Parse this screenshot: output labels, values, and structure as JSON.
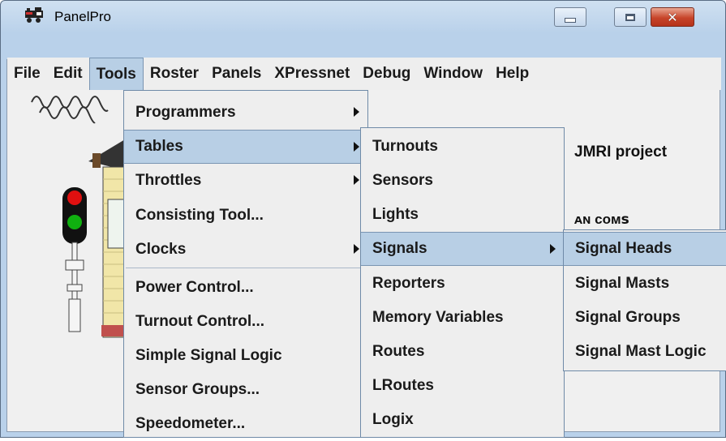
{
  "window": {
    "title": "PanelPro",
    "minimize": "minimize",
    "maximize": "maximize",
    "close": "✕"
  },
  "menubar": {
    "items": [
      "File",
      "Edit",
      "Tools",
      "Roster",
      "Panels",
      "XPressnet",
      "Debug",
      "Window",
      "Help"
    ],
    "active": "Tools"
  },
  "background": {
    "jmri_text": "JMRI project",
    "partial_text": "ᴀɴ ᴄᴏᴍꜱ"
  },
  "tools_menu": {
    "items": [
      {
        "label": "Programmers",
        "submenu": true
      },
      {
        "label": "Tables",
        "submenu": true,
        "highlighted": true
      },
      {
        "label": "Throttles",
        "submenu": true
      },
      {
        "label": "Consisting Tool...",
        "submenu": false
      },
      {
        "label": "Clocks",
        "submenu": true
      },
      {
        "label": "Power Control...",
        "submenu": false
      },
      {
        "label": "Turnout Control...",
        "submenu": false
      },
      {
        "label": "Simple Signal Logic",
        "submenu": false
      },
      {
        "label": "Sensor Groups...",
        "submenu": false
      },
      {
        "label": "Speedometer...",
        "submenu": false
      }
    ]
  },
  "tables_menu": {
    "items": [
      {
        "label": "Turnouts",
        "submenu": false
      },
      {
        "label": "Sensors",
        "submenu": false
      },
      {
        "label": "Lights",
        "submenu": false
      },
      {
        "label": "Signals",
        "submenu": true,
        "highlighted": true
      },
      {
        "label": "Reporters",
        "submenu": false
      },
      {
        "label": "Memory Variables",
        "submenu": false
      },
      {
        "label": "Routes",
        "submenu": false
      },
      {
        "label": "LRoutes",
        "submenu": false
      },
      {
        "label": "Logix",
        "submenu": false
      }
    ]
  },
  "signals_menu": {
    "items": [
      {
        "label": "Signal Heads",
        "highlighted": true
      },
      {
        "label": "Signal Masts"
      },
      {
        "label": "Signal Groups"
      },
      {
        "label": "Signal Mast Logic"
      }
    ]
  },
  "colors": {
    "menu_highlight": "#b8cfe5",
    "menu_bg": "#eeeeee",
    "close_button": "#c7452a",
    "signal_red": "#e01010",
    "signal_green": "#10b010"
  }
}
